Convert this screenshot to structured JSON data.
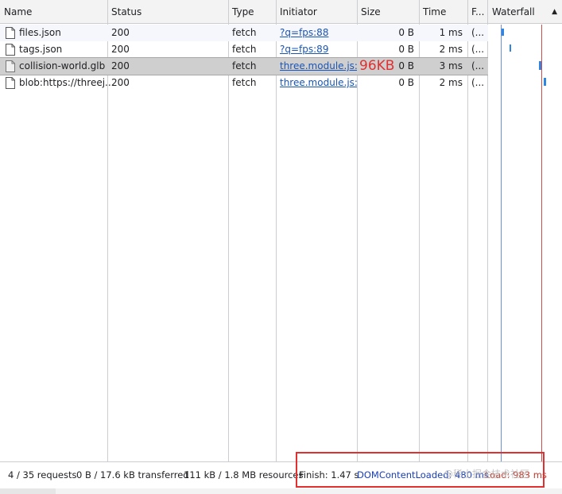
{
  "columns": {
    "name": "Name",
    "status": "Status",
    "type": "Type",
    "initiator": "Initiator",
    "size": "Size",
    "time": "Time",
    "f": "F...",
    "waterfall": "Waterfall"
  },
  "sort_icon": "▲",
  "rows": [
    {
      "name": "files.json",
      "status": "200",
      "type": "fetch",
      "initiator": "?q=fps:88",
      "size": "0 B",
      "time": "1 ms",
      "f": "(..."
    },
    {
      "name": "tags.json",
      "status": "200",
      "type": "fetch",
      "initiator": "?q=fps:89",
      "size": "0 B",
      "time": "2 ms",
      "f": "(..."
    },
    {
      "name": "collision-world.glb",
      "status": "200",
      "type": "fetch",
      "initiator": "three.module.js:...",
      "size": "0 B",
      "time": "3 ms",
      "f": "(..."
    },
    {
      "name": "blob:https://threej...",
      "status": "200",
      "type": "fetch",
      "initiator": "three.module.js:...",
      "size": "0 B",
      "time": "2 ms",
      "f": "(..."
    }
  ],
  "annotation": "96KB",
  "footer": {
    "requests": "4 / 35 requests",
    "transferred": "0 B / 17.6 kB transferred",
    "resources": "111 kB / 1.8 MB resources",
    "finish": "Finish: 1.47 s",
    "dom_content_loaded": "DOMContentLoaded: 480 ms",
    "load": "Load: 983 ms"
  },
  "watermark": "@稀土掘金技术社区",
  "colors": {
    "annotation": "#e03030",
    "link": "#1a55b6",
    "dom_content_loaded": "#1a3fb6",
    "load": "#c0392b"
  }
}
